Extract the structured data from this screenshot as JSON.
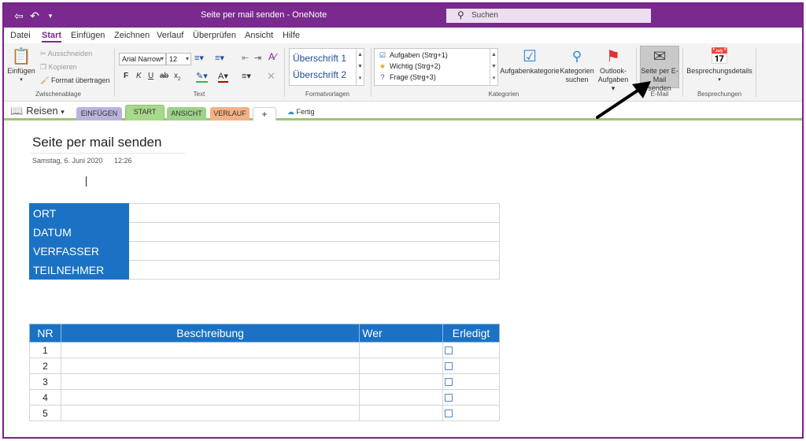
{
  "titlebar": {
    "back_icon": "back-icon",
    "undo_icon": "undo-icon",
    "title": "Seite per mail senden  -  OneNote",
    "search_placeholder": "Suchen"
  },
  "ribbon_tabs": [
    "Datei",
    "Start",
    "Einfügen",
    "Zeichnen",
    "Verlauf",
    "Überprüfen",
    "Ansicht",
    "Hilfe"
  ],
  "active_tab": "Start",
  "clipboard": {
    "paste": "Einfügen",
    "cut": "Ausschneiden",
    "copy": "Kopieren",
    "format_painter": "Format übertragen",
    "label": "Zwischenablage"
  },
  "text_group": {
    "font": "Arial Narrow",
    "size": "12",
    "bold": "F",
    "italic": "K",
    "underline": "U",
    "strike": "ab",
    "subscript": "x",
    "label": "Text"
  },
  "styles": {
    "items": [
      "Überschrift 1",
      "Überschrift 2"
    ],
    "label": "Formatvorlagen"
  },
  "tags": {
    "items": [
      "Aufgaben (Strg+1)",
      "Wichtig (Strg+2)",
      "Frage (Strg+3)"
    ],
    "task_category": "Aufgabenkategorie",
    "search_tags_1": "Kategorien",
    "search_tags_2": "suchen",
    "outlook_1": "Outlook-",
    "outlook_2": "Aufgaben",
    "label": "Kategorien"
  },
  "email": {
    "send_1": "Seite per E-",
    "send_2": "Mail senden",
    "label": "E-Mail"
  },
  "meetings": {
    "details": "Besprechungsdetails",
    "label": "Besprechungen"
  },
  "notebook": {
    "name": "Reisen",
    "sections": [
      "EINFÜGEN",
      "START",
      "ANSICHT",
      "VERLAUF",
      "+"
    ],
    "section_colors": [
      "#b9b4dd",
      "#a8d88b",
      "#9ed28a",
      "#f4b183",
      "#ffffff"
    ],
    "active_section": "START",
    "status": "Fertig"
  },
  "page": {
    "title": "Seite per mail senden",
    "date": "Samstag, 6. Juni 2020",
    "time": "12:26"
  },
  "info_table": {
    "rows": [
      "ORT",
      "DATUM",
      "VERFASSER",
      "TEILNEHMER"
    ]
  },
  "task_table": {
    "headers": [
      "NR",
      "Beschreibung",
      "Wer",
      "Erledigt"
    ],
    "rows": [
      "1",
      "2",
      "3",
      "4",
      "5"
    ]
  },
  "colors": {
    "accent": "#7a2a8e",
    "table_header": "#1b72c4",
    "section_line": "#9dc47a"
  }
}
